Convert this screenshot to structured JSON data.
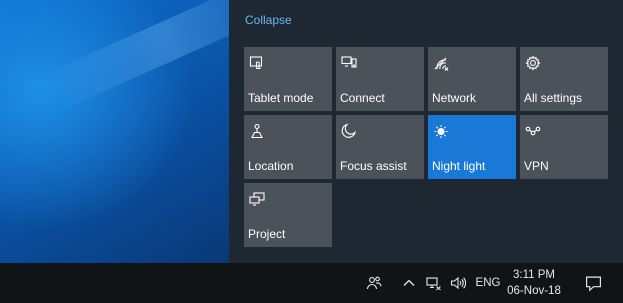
{
  "action_center": {
    "collapse_label": "Collapse",
    "tiles": [
      {
        "label": "Tablet mode",
        "icon": "tablet-mode-icon",
        "active": false
      },
      {
        "label": "Connect",
        "icon": "connect-icon",
        "active": false
      },
      {
        "label": "Network",
        "icon": "network-icon",
        "active": false
      },
      {
        "label": "All settings",
        "icon": "gear-icon",
        "active": false
      },
      {
        "label": "Location",
        "icon": "location-icon",
        "active": false
      },
      {
        "label": "Focus assist",
        "icon": "moon-icon",
        "active": false
      },
      {
        "label": "Night light",
        "icon": "night-light-icon",
        "active": true
      },
      {
        "label": "VPN",
        "icon": "vpn-icon",
        "active": false
      },
      {
        "label": "Project",
        "icon": "project-icon",
        "active": false
      }
    ]
  },
  "taskbar": {
    "tray_icons": [
      "people-icon",
      "chevron-up-icon",
      "network-icon",
      "volume-icon"
    ],
    "language": "ENG",
    "time": "3:11 PM",
    "date": "06-Nov-18",
    "notification_icon": "notification-icon"
  },
  "colors": {
    "accent": "#1a78d6",
    "tile": "#4b525a",
    "panel": "#1d2833",
    "taskbar": "#101417",
    "link": "#6ab7f0"
  }
}
